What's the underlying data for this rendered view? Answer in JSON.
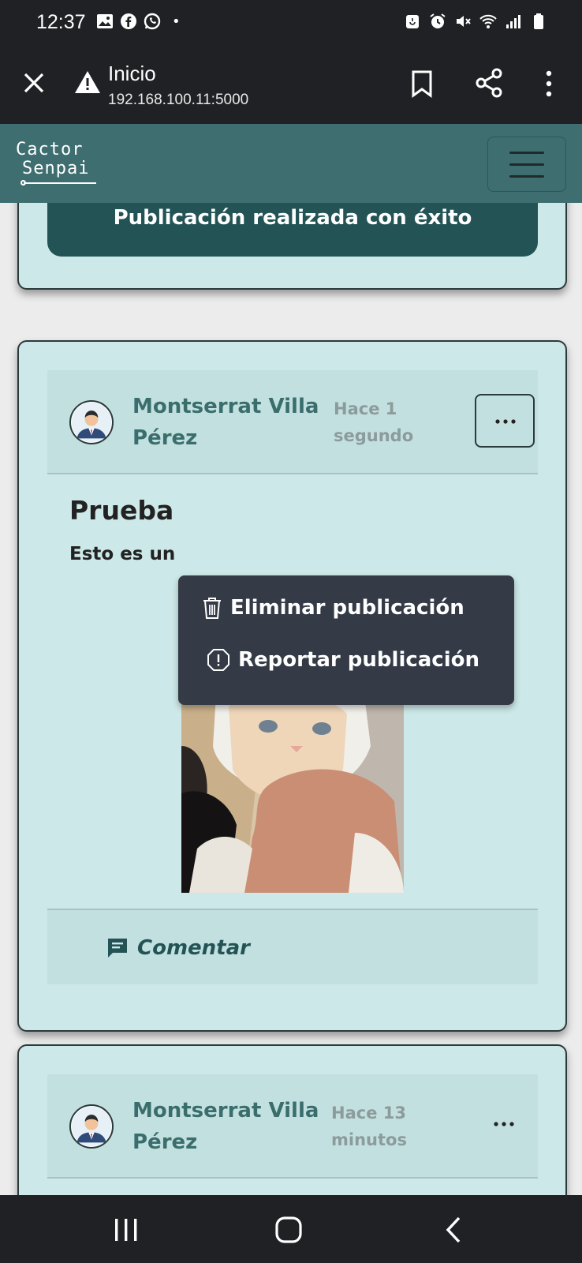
{
  "status_bar": {
    "time": "12:37",
    "dot": "•",
    "icons_left": [
      "gallery-icon",
      "facebook-icon",
      "whatsapp-icon"
    ],
    "icons_right": [
      "battery-saver-icon",
      "alarm-icon",
      "mute-icon",
      "wifi-icon",
      "signal-icon",
      "battery-icon"
    ]
  },
  "browser": {
    "title": "Inicio",
    "url": "192.168.100.11:5000",
    "icons": [
      "close-icon",
      "warning-icon",
      "bookmark-icon",
      "share-icon",
      "more-vert-icon"
    ]
  },
  "navbar": {
    "logo_line1": "Cactor",
    "logo_line2": "Senpai",
    "menu_icon": "hamburger-icon",
    "color": "#3f6e71"
  },
  "alert": {
    "message": "Publicación realizada con éxito",
    "color": "#245356"
  },
  "posts": [
    {
      "author": "Montserrat Villa Pérez",
      "time": "Hace 1 segundo",
      "title": "Prueba",
      "text": "Esto es un",
      "image": "cat-reindeer-photo",
      "comment_label": "Comentar"
    },
    {
      "author": "Montserrat Villa Pérez",
      "time": "Hace 13 minutos"
    }
  ],
  "dropdown": {
    "items": [
      {
        "label": "Eliminar publicación",
        "icon": "trash-icon"
      },
      {
        "label": "Reportar publicación",
        "icon": "report-icon"
      }
    ]
  },
  "system_nav": [
    "recent-apps-icon",
    "home-icon",
    "back-icon"
  ]
}
